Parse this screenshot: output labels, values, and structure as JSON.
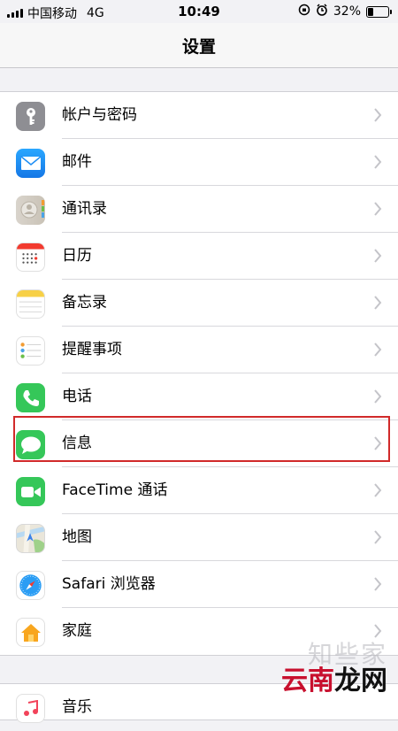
{
  "status_bar": {
    "carrier": "中国移动",
    "network": "4G",
    "time": "10:49",
    "battery_percent_text": "32%",
    "battery_level": 0.32
  },
  "nav": {
    "title": "设置"
  },
  "settings_items": [
    {
      "label": "帐户与密码",
      "icon": "key-icon"
    },
    {
      "label": "邮件",
      "icon": "mail-icon"
    },
    {
      "label": "通讯录",
      "icon": "contacts-icon"
    },
    {
      "label": "日历",
      "icon": "calendar-icon"
    },
    {
      "label": "备忘录",
      "icon": "notes-icon"
    },
    {
      "label": "提醒事项",
      "icon": "reminders-icon"
    },
    {
      "label": "电话",
      "icon": "phone-icon"
    },
    {
      "label": "信息",
      "icon": "messages-icon",
      "highlighted": true
    },
    {
      "label": "FaceTime 通话",
      "icon": "facetime-icon"
    },
    {
      "label": "地图",
      "icon": "maps-icon"
    },
    {
      "label": "Safari 浏览器",
      "icon": "safari-icon"
    },
    {
      "label": "家庭",
      "icon": "home-icon"
    }
  ],
  "next_group": {
    "label": "音乐",
    "icon": "music-icon"
  },
  "watermark": {
    "text": "云南龙网",
    "ghost_text": "知些家"
  },
  "colors": {
    "highlight": "#d12a2a",
    "mail": "#1e8ef5",
    "phone": "#35c759",
    "messages": "#35c759",
    "facetime": "#35c759",
    "watermark_red": "#c8102e"
  }
}
